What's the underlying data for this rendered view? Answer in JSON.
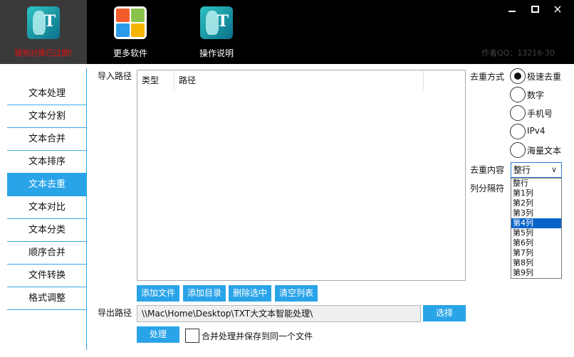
{
  "header": {
    "buttons": [
      {
        "label": "猫狗对撕已过期!",
        "icon": "book-app-icon"
      },
      {
        "label": "更多软件",
        "icon": "tiles-app-icon"
      },
      {
        "label": "操作说明",
        "icon": "book-app-icon"
      }
    ],
    "window": {
      "minimize": "minimize-icon",
      "maximize": "maximize-icon",
      "close": "×"
    },
    "qq_text": "作者QQ：13216·30"
  },
  "sidebar": {
    "items": [
      {
        "label": "文本处理"
      },
      {
        "label": "文本分割"
      },
      {
        "label": "文本合并"
      },
      {
        "label": "文本排序"
      },
      {
        "label": "文本去重",
        "active": true
      },
      {
        "label": "文本对比"
      },
      {
        "label": "文本分类"
      },
      {
        "label": "顺序合并"
      },
      {
        "label": "文件转换"
      },
      {
        "label": "格式调整"
      }
    ]
  },
  "main": {
    "import_label": "导入路径",
    "columns": {
      "type": "类型",
      "path": "路径"
    },
    "buttons": {
      "add_file": "添加文件",
      "add_dir": "添加目录",
      "delete_selected": "删除选中",
      "clear_list": "清空列表",
      "choose": "选择",
      "process": "处理"
    },
    "export_label": "导出路径",
    "export_path": "\\\\Mac\\Home\\Desktop\\TXT大文本智能处理\\",
    "merge_checkbox": "合并处理并保存到同一个文件"
  },
  "right": {
    "dedupe_method_label": "去重方式",
    "methods": [
      {
        "label": "极速去重",
        "selected": true
      },
      {
        "label": "数字",
        "selected": false
      },
      {
        "label": "手机号",
        "selected": false
      },
      {
        "label": "IPv4",
        "selected": false
      },
      {
        "label": "海量文本",
        "selected": false
      }
    ],
    "dedupe_content_label": "去重内容",
    "selected_value": "整行",
    "column_sep_label": "列分隔符",
    "options": [
      "整行",
      "第1列",
      "第2列",
      "第3列",
      "第4列",
      "第5列",
      "第6列",
      "第7列",
      "第8列",
      "第9列"
    ],
    "highlighted_option": "第4列"
  },
  "colors": {
    "accent": "#2aa4e8",
    "header_bg": "#000000",
    "warning": "#dd1111",
    "dropdown_highlight": "#0a64c8"
  }
}
